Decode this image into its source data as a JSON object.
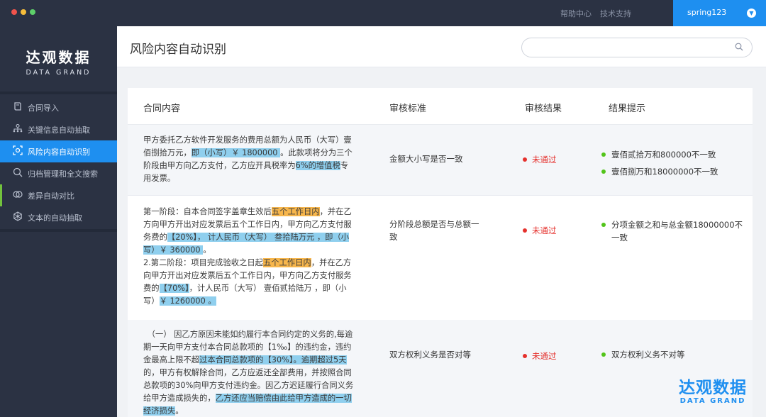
{
  "window": {
    "dots": [
      "#f0534c",
      "#f6bd3b",
      "#5ed06a"
    ],
    "nav": [
      "帮助中心",
      "技术支持"
    ],
    "user": "spring123"
  },
  "logo": {
    "cn": "达观数据",
    "en": "DATA GRAND"
  },
  "sidebar": {
    "items": [
      {
        "label": "合同导入",
        "icon": "book-icon"
      },
      {
        "label": "关键信息自动抽取",
        "icon": "hierarchy-icon"
      },
      {
        "label": "风险内容自动识别",
        "icon": "scan-icon",
        "active": true
      },
      {
        "label": "归档管理和全文搜索",
        "icon": "search-icon"
      },
      {
        "label": "差异自动对比",
        "icon": "compare-icon"
      },
      {
        "label": "文本的自动抽取",
        "icon": "network-icon"
      }
    ]
  },
  "header": {
    "title": "风险内容自动识别",
    "search_placeholder": ""
  },
  "table": {
    "headers": [
      "合同内容",
      "审核标准",
      "审核结果",
      "结果提示"
    ],
    "rows": [
      {
        "standard": "金额大小写是否一致",
        "result": "未通过",
        "hints": [
          "壹佰贰拾万和800000不一致",
          "壹佰捌万和18000000不一致"
        ],
        "text": [
          {
            "t": "甲方委托乙方软件开发服务的费用总额为人民币（大写）壹佰捌拾万元，"
          },
          {
            "t": "即（小写）￥ 1800000 ",
            "hl": "b"
          },
          {
            "t": "。此款项将分为三个阶段由甲方向乙方支付，乙方应开具税率为"
          },
          {
            "t": "6%的增值税",
            "hl": "b"
          },
          {
            "t": "专用发票。"
          }
        ]
      },
      {
        "standard": "分阶段总额是否与总额一致",
        "result": "未通过",
        "hints": [
          "分项金额之和与总金额18000000不一致"
        ],
        "text": [
          {
            "t": "第一阶段：自本合同签字盖章生效后"
          },
          {
            "t": "五个工作日内",
            "hl": "o"
          },
          {
            "t": "，并在乙方向甲方开出对应发票后五个工作日内，甲方向乙方支付服务费的"
          },
          {
            "t": "【20%】， 计人民币（大写） 叁拾陆万元 ，即（小写）￥ 360000 ",
            "hl": "b"
          },
          {
            "t": "。"
          },
          {
            "t": "\n2.第二阶段：项目完成验收之日起"
          },
          {
            "t": "五个工作日内",
            "hl": "o"
          },
          {
            "t": "，并在乙方向甲方开出对应发票后五个工作日内，甲方向乙方支付服务费的"
          },
          {
            "t": "【70%】",
            "hl": "b"
          },
          {
            "t": "，计人民币（大写） 壹佰贰拾陆万 ，即（小写）"
          },
          {
            "t": "￥ 1260000 。",
            "hl": "b"
          }
        ]
      },
      {
        "standard": "双方权利义务是否对等",
        "result": "未通过",
        "hints": [
          "双方权利义务不对等"
        ],
        "text": [
          {
            "t": "　（一） 因乙方原因未能如约履行本合同约定的义务的,每逾期一天向甲方支付本合同总款项的【1‰】的违约金，违约金最高上限不超"
          },
          {
            "t": "过本合同总款项的【30%】。逾期超过5天",
            "hl": "b"
          },
          {
            "t": "的，甲方有权解除合同，乙方应返还全部费用，并按照合同总款项的30%向甲方支付违约金。因乙方迟延履行合同义务给甲方造成损失的，"
          },
          {
            "t": "乙方还应当赔偿由此给甲方造成的一切经济损失",
            "hl": "b"
          },
          {
            "t": "。"
          }
        ]
      }
    ]
  },
  "watermark": {
    "cn": "达观数据",
    "en": "DATA GRAND"
  }
}
